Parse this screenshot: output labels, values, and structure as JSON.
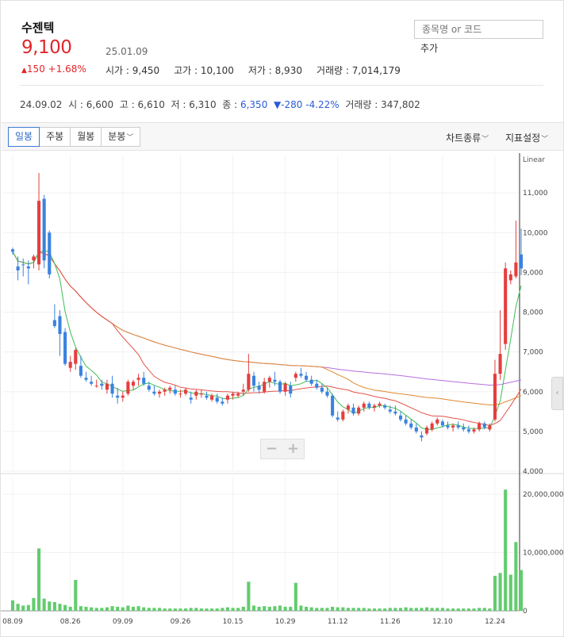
{
  "stock": {
    "name": "수젠텍",
    "price": "9,100",
    "date": "25.01.09",
    "change_arrow": "▲",
    "change_value": "150",
    "change_pct": "+1.68%",
    "open": "시가 : 9,450",
    "high": "고가 : 10,100",
    "low": "저가 : 8,930",
    "volume": "거래량 : 7,014,179"
  },
  "search": {
    "placeholder": "종목명 or 코드",
    "add_label": "추가"
  },
  "hover_info": {
    "date": "24.09.02",
    "open": "시 : 6,600",
    "high": "고 : 6,610",
    "low": "저 : 6,310",
    "close_label": "종 :",
    "close_value": "6,350",
    "change": "▼-280 -4.22%",
    "volume": "거래량 : 347,802"
  },
  "toolbar": {
    "tabs": [
      "일봉",
      "주봉",
      "월봉",
      "분봉"
    ],
    "active_tab": 0,
    "chart_type": "차트종류",
    "indicator": "지표설정"
  },
  "colors": {
    "up": "#e1262b",
    "down": "#2a5bd7",
    "candle_up": "#e53e3e",
    "candle_down": "#3b82e0",
    "ma5": "#3fbf54",
    "ma20": "#e2544a",
    "ma60": "#e08a2c",
    "ma120": "#b76ee0",
    "volume_bar": "#62cc6e"
  },
  "chart_data": {
    "type": "candlestick",
    "scale_label": "Linear",
    "price_ylim": [
      4000,
      12000
    ],
    "price_ticks": [
      "11,000",
      "10,000",
      "9,000",
      "8,000",
      "7,000",
      "6,000",
      "5,000",
      "4,000"
    ],
    "price_tick_values": [
      11000,
      10000,
      9000,
      8000,
      7000,
      6000,
      5000,
      4000
    ],
    "volume_ylim": [
      0,
      23000000
    ],
    "volume_ticks": [
      "20,000,000",
      "10,000,000",
      "0"
    ],
    "volume_tick_values": [
      20000000,
      10000000,
      0
    ],
    "x_labels": [
      "08.09",
      "08.26",
      "09.09",
      "09.26",
      "10.15",
      "10.29",
      "11.12",
      "11.26",
      "12.10",
      "12.24"
    ],
    "x_label_index": [
      0,
      11,
      21,
      32,
      42,
      52,
      62,
      72,
      82,
      92
    ],
    "candles": [
      [
        9580,
        9620,
        9450,
        9520,
        1800000
      ],
      [
        9150,
        9400,
        8800,
        9050,
        1200000
      ],
      [
        9200,
        9350,
        8900,
        9180,
        900000
      ],
      [
        9150,
        9300,
        8700,
        9100,
        1000000
      ],
      [
        9300,
        9450,
        9100,
        9400,
        2200000
      ],
      [
        9200,
        11500,
        9050,
        10800,
        10700000
      ],
      [
        10850,
        10950,
        9100,
        9300,
        2100000
      ],
      [
        10000,
        10050,
        8850,
        8950,
        1600000
      ],
      [
        7800,
        8200,
        7600,
        7650,
        1500000
      ],
      [
        7900,
        8050,
        6900,
        7450,
        1200000
      ],
      [
        7500,
        7600,
        6650,
        6700,
        1000000
      ],
      [
        6600,
        6900,
        6500,
        6750,
        700000
      ],
      [
        6700,
        7100,
        6550,
        7050,
        5300000
      ],
      [
        6650,
        6900,
        6350,
        6400,
        800000
      ],
      [
        6350,
        6500,
        6250,
        6300,
        700000
      ],
      [
        6250,
        6400,
        6150,
        6200,
        600000
      ],
      [
        6150,
        6300,
        6100,
        6150,
        500000
      ],
      [
        6200,
        6300,
        6050,
        6150,
        500000
      ],
      [
        6050,
        6300,
        5950,
        6200,
        600000
      ],
      [
        6200,
        6400,
        5850,
        5950,
        800000
      ],
      [
        5900,
        6100,
        5700,
        5850,
        700000
      ],
      [
        5850,
        6000,
        5750,
        5900,
        600000
      ],
      [
        5950,
        6300,
        5900,
        6250,
        900000
      ],
      [
        6150,
        6300,
        6050,
        6250,
        700000
      ],
      [
        6300,
        6450,
        6150,
        6350,
        800000
      ],
      [
        6350,
        6500,
        6150,
        6200,
        600000
      ],
      [
        6150,
        6250,
        6000,
        6050,
        500000
      ],
      [
        6000,
        6150,
        5900,
        5950,
        500000
      ],
      [
        5950,
        6050,
        5850,
        6000,
        500000
      ],
      [
        6000,
        6100,
        5900,
        6050,
        400000
      ],
      [
        6050,
        6150,
        5950,
        6100,
        400000
      ],
      [
        6050,
        6150,
        5900,
        5950,
        400000
      ],
      [
        5950,
        6050,
        5850,
        5950,
        400000
      ],
      [
        5950,
        6100,
        5900,
        6050,
        400000
      ],
      [
        5850,
        6000,
        5700,
        5800,
        500000
      ],
      [
        5900,
        6050,
        5800,
        6000,
        500000
      ],
      [
        5950,
        6050,
        5850,
        5950,
        400000
      ],
      [
        5900,
        6000,
        5800,
        5850,
        400000
      ],
      [
        5800,
        5950,
        5750,
        5900,
        400000
      ],
      [
        5850,
        5950,
        5700,
        5750,
        400000
      ],
      [
        5750,
        5850,
        5650,
        5700,
        500000
      ],
      [
        5800,
        5950,
        5700,
        5900,
        600000
      ],
      [
        5900,
        6000,
        5800,
        5950,
        500000
      ],
      [
        5900,
        6000,
        5850,
        5950,
        500000
      ],
      [
        6000,
        6200,
        5900,
        6050,
        700000
      ],
      [
        6050,
        6950,
        6000,
        6450,
        5000000
      ],
      [
        6400,
        6500,
        6000,
        6150,
        900000
      ],
      [
        6150,
        6250,
        5950,
        6050,
        700000
      ],
      [
        6000,
        6350,
        5950,
        6250,
        800000
      ],
      [
        6250,
        6400,
        6100,
        6350,
        700000
      ],
      [
        6300,
        6500,
        6150,
        6250,
        800000
      ],
      [
        6250,
        6300,
        5950,
        6000,
        900000
      ],
      [
        6000,
        6250,
        5900,
        6200,
        700000
      ],
      [
        6150,
        6250,
        5850,
        5950,
        700000
      ],
      [
        6350,
        6500,
        6250,
        6450,
        4800000
      ],
      [
        6450,
        6600,
        6350,
        6400,
        900000
      ],
      [
        6400,
        6500,
        6250,
        6300,
        700000
      ],
      [
        6300,
        6400,
        6150,
        6200,
        600000
      ],
      [
        6200,
        6300,
        6050,
        6100,
        500000
      ],
      [
        6100,
        6200,
        5950,
        6000,
        500000
      ],
      [
        6000,
        6100,
        5850,
        5900,
        500000
      ],
      [
        5900,
        5950,
        5350,
        5400,
        700000
      ],
      [
        5350,
        5500,
        5250,
        5300,
        600000
      ],
      [
        5300,
        5550,
        5250,
        5500,
        600000
      ],
      [
        5550,
        5700,
        5450,
        5650,
        500000
      ],
      [
        5600,
        5700,
        5400,
        5450,
        500000
      ],
      [
        5450,
        5650,
        5400,
        5600,
        500000
      ],
      [
        5600,
        5750,
        5500,
        5700,
        500000
      ],
      [
        5700,
        5750,
        5550,
        5600,
        400000
      ],
      [
        5600,
        5700,
        5500,
        5650,
        400000
      ],
      [
        5650,
        5750,
        5600,
        5700,
        400000
      ],
      [
        5650,
        5700,
        5550,
        5600,
        400000
      ],
      [
        5550,
        5650,
        5450,
        5500,
        500000
      ],
      [
        5500,
        5650,
        5400,
        5450,
        500000
      ],
      [
        5400,
        5500,
        5250,
        5300,
        500000
      ],
      [
        5300,
        5400,
        5150,
        5200,
        600000
      ],
      [
        5200,
        5300,
        5050,
        5100,
        500000
      ],
      [
        5100,
        5200,
        4950,
        5000,
        500000
      ],
      [
        4900,
        5000,
        4750,
        4850,
        500000
      ],
      [
        4950,
        5150,
        4900,
        5100,
        600000
      ],
      [
        5050,
        5250,
        5000,
        5200,
        500000
      ],
      [
        5200,
        5350,
        5150,
        5300,
        500000
      ],
      [
        5250,
        5300,
        5100,
        5150,
        500000
      ],
      [
        5150,
        5250,
        5050,
        5100,
        400000
      ],
      [
        5100,
        5200,
        5000,
        5150,
        400000
      ],
      [
        5150,
        5250,
        5050,
        5100,
        400000
      ],
      [
        5100,
        5200,
        5000,
        5050,
        400000
      ],
      [
        5050,
        5150,
        4950,
        5000,
        400000
      ],
      [
        5000,
        5100,
        4950,
        5050,
        400000
      ],
      [
        5050,
        5250,
        5000,
        5200,
        500000
      ],
      [
        5200,
        5250,
        5050,
        5100,
        500000
      ],
      [
        5050,
        5200,
        5000,
        5150,
        400000
      ],
      [
        5300,
        6800,
        5250,
        6450,
        6000000
      ],
      [
        6450,
        8050,
        6300,
        6950,
        6500000
      ],
      [
        7200,
        9250,
        7050,
        9100,
        20800000
      ],
      [
        8800,
        9050,
        8700,
        8950,
        6200000
      ],
      [
        8900,
        10300,
        8850,
        9250,
        11800000
      ],
      [
        9450,
        10100,
        8930,
        9100,
        7000000
      ]
    ]
  }
}
